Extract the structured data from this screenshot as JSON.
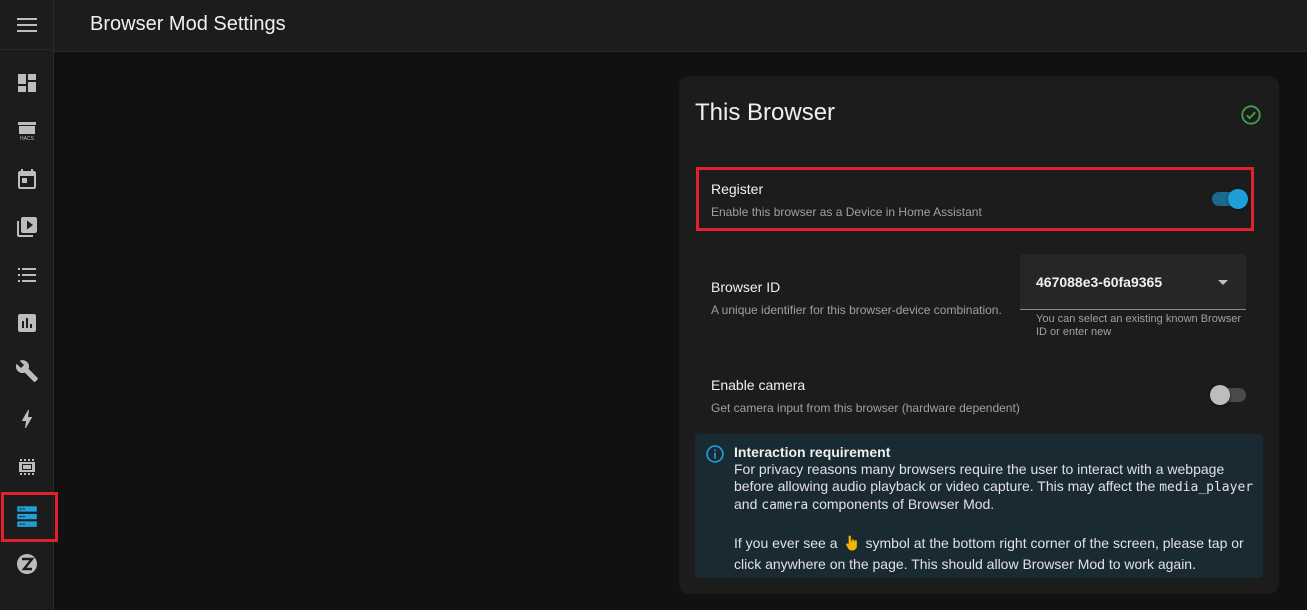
{
  "header": {
    "title": "Browser Mod Settings"
  },
  "sidebar": {
    "items": [
      {
        "name": "overview",
        "icon": "dashboard-icon"
      },
      {
        "name": "hacs",
        "icon": "hacs-icon",
        "badge": "HACS"
      },
      {
        "name": "calendar",
        "icon": "calendar-icon"
      },
      {
        "name": "media",
        "icon": "media-play-icon"
      },
      {
        "name": "todo",
        "icon": "list-icon"
      },
      {
        "name": "history",
        "icon": "chart-icon"
      },
      {
        "name": "developer-tools",
        "icon": "wrench-icon"
      },
      {
        "name": "energy",
        "icon": "lightning-icon"
      },
      {
        "name": "esphome",
        "icon": "chip-icon"
      },
      {
        "name": "browser-mod",
        "icon": "server-icon",
        "active": true
      },
      {
        "name": "zwave",
        "icon": "zwave-icon"
      }
    ]
  },
  "card": {
    "title": "This Browser",
    "register": {
      "title": "Register",
      "subtitle": "Enable this browser as a Device in Home Assistant",
      "enabled": true
    },
    "browser_id": {
      "title": "Browser ID",
      "subtitle": "A unique identifier for this browser-device combination.",
      "value": "467088e3-60fa9365",
      "helper": "You can select an existing known Browser ID or enter new"
    },
    "camera": {
      "title": "Enable camera",
      "subtitle": "Get camera input from this browser (hardware dependent)",
      "enabled": false
    },
    "alert": {
      "title": "Interaction requirement",
      "line1": "For privacy reasons many browsers require the user to interact with a webpage before allowing audio playback or video capture. This may affect the",
      "code1": "media_player",
      "and": "and",
      "code2": "camera",
      "line1_end": "components of Browser Mod.",
      "p2_start": "If you ever see a",
      "p2_end": "symbol at the bottom right corner of the screen, please tap or click anywhere on the page. This should allow Browser Mod to work again."
    }
  },
  "colors": {
    "accent": "#1e9fd8",
    "highlight": "#e3212b",
    "success": "#43a047",
    "info": "#1e9fd8"
  }
}
